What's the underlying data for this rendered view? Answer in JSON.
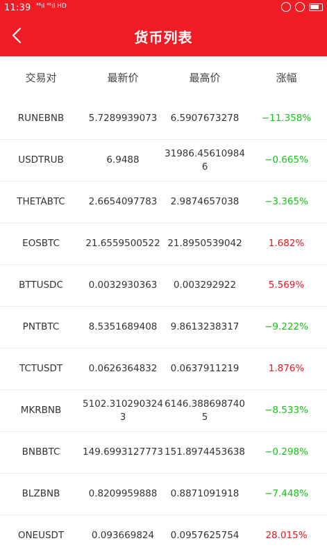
{
  "status_bar": {
    "time": "11:39",
    "signals": "⁴⁶ıl ⁴⁶ıl HD"
  },
  "header": {
    "title": "货币列表"
  },
  "table": {
    "columns": [
      "交易对",
      "最新价",
      "最高价",
      "涨幅"
    ],
    "rows": [
      {
        "pair": "RUNEBNB",
        "last": "5.7289939073",
        "high": "6.5907673278",
        "change": "−11.358%",
        "direction": "down"
      },
      {
        "pair": "USDTRUB",
        "last": "6.9488",
        "high": "31986.456109846",
        "change": "−0.665%",
        "direction": "down"
      },
      {
        "pair": "THETABTC",
        "last": "2.6654097783",
        "high": "2.9874657038",
        "change": "−3.365%",
        "direction": "down"
      },
      {
        "pair": "EOSBTC",
        "last": "21.6559500522",
        "high": "21.8950539042",
        "change": "1.682%",
        "direction": "up"
      },
      {
        "pair": "BTTUSDC",
        "last": "0.0032930363",
        "high": "0.003292922",
        "change": "5.569%",
        "direction": "up"
      },
      {
        "pair": "PNTBTC",
        "last": "8.5351689408",
        "high": "9.8613238317",
        "change": "−9.222%",
        "direction": "down"
      },
      {
        "pair": "TCTUSDT",
        "last": "0.0626364832",
        "high": "0.0637911219",
        "change": "1.876%",
        "direction": "up"
      },
      {
        "pair": "MKRBNB",
        "last": "5102.3102903243",
        "high": "6146.3886987405",
        "change": "−8.533%",
        "direction": "down"
      },
      {
        "pair": "BNBBTC",
        "last": "149.6993127773",
        "high": "151.8974453638",
        "change": "−0.298%",
        "direction": "down"
      },
      {
        "pair": "BLZBNB",
        "last": "0.8209959888",
        "high": "0.8871091918",
        "change": "−7.448%",
        "direction": "down"
      },
      {
        "pair": "ONEUSDT",
        "last": "0.093669824",
        "high": "0.0957625754",
        "change": "28.015%",
        "direction": "up"
      }
    ]
  },
  "colors": {
    "brand_red": "#ee1c25",
    "up": "#f0141e",
    "down": "#14c414"
  }
}
